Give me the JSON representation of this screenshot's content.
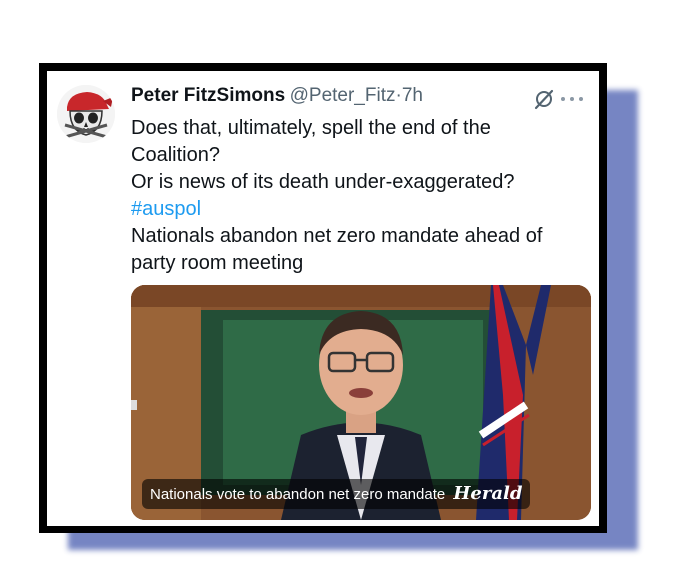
{
  "tweet": {
    "author_name": "Peter FitzSimons",
    "handle": "@Peter_Fitz",
    "separator": "·",
    "time": "7h",
    "lines": [
      "Does that, ultimately, spell the end of the",
      "Coalition?",
      "Or is news of its death under-exaggerated?"
    ],
    "hashtag": "#auspol",
    "headline_lines": [
      "Nationals abandon net zero mandate ahead of",
      "party room meeting"
    ]
  },
  "media": {
    "caption": "Nationals vote to abandon net zero mandate",
    "publisher": "Herald"
  },
  "icons": {
    "avatar": "pirate-skull-avatar",
    "grok": "grok-slash-icon",
    "more": "more-dots-icon"
  },
  "colors": {
    "hashtag": "#1d9bf0",
    "frame_shadow": "#6f7fc0"
  }
}
